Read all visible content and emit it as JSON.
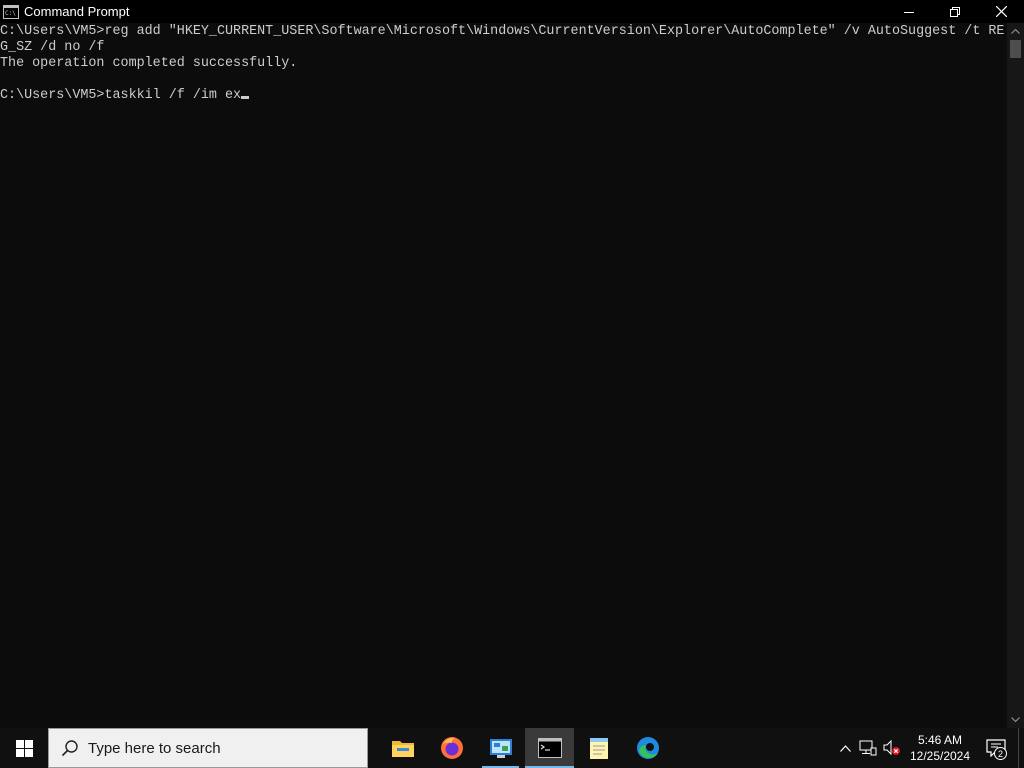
{
  "window": {
    "title": "Command Prompt"
  },
  "console": {
    "lines": [
      "C:\\Users\\VM5>reg add \"HKEY_CURRENT_USER\\Software\\Microsoft\\Windows\\CurrentVersion\\Explorer\\AutoComplete\" /v AutoSuggest /t RE",
      "G_SZ /d no /f",
      "The operation completed successfully.",
      "",
      "C:\\Users\\VM5>taskkil /f /im ex"
    ]
  },
  "taskbar": {
    "search_placeholder": "Type here to search",
    "apps": [
      {
        "icon": "file-explorer-icon"
      },
      {
        "icon": "firefox-icon"
      },
      {
        "icon": "control-panel-icon"
      },
      {
        "icon": "command-prompt-icon"
      },
      {
        "icon": "notepad-icon"
      },
      {
        "icon": "edge-icon"
      }
    ],
    "clock_time": "5:46 AM",
    "clock_date": "12/25/2024",
    "notification_count": "2"
  },
  "colors": {
    "console_bg": "#0c0c0c",
    "console_text": "#cccccc",
    "taskbar_bg": "#101010",
    "accent": "#76b9ed"
  }
}
